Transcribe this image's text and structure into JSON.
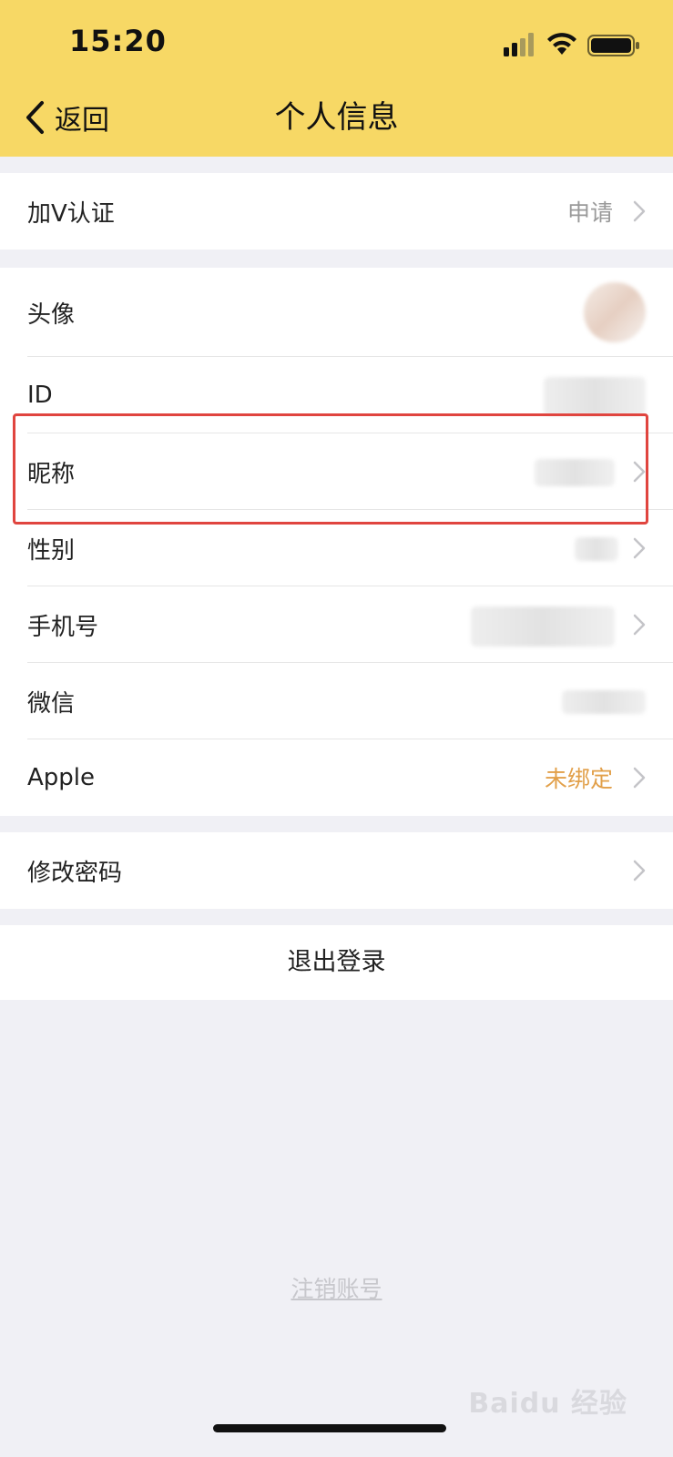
{
  "status_bar": {
    "time": "15:20"
  },
  "nav": {
    "back_label": "返回",
    "title": "个人信息"
  },
  "groups": {
    "verify": {
      "label": "加V认证",
      "value": "申请"
    },
    "profile": {
      "avatar_label": "头像",
      "id_label": "ID",
      "nickname_label": "昵称",
      "gender_label": "性别",
      "phone_label": "手机号",
      "wechat_label": "微信",
      "apple_label": "Apple",
      "apple_value": "未绑定"
    },
    "security": {
      "password_label": "修改密码"
    }
  },
  "logout_label": "退出登录",
  "cancel_account_label": "注销账号",
  "watermark": "Baidu 经验",
  "colors": {
    "header": "#f7d865",
    "highlight": "#e0453f",
    "warning_value": "#e2a04a",
    "background": "#f0f0f5"
  }
}
